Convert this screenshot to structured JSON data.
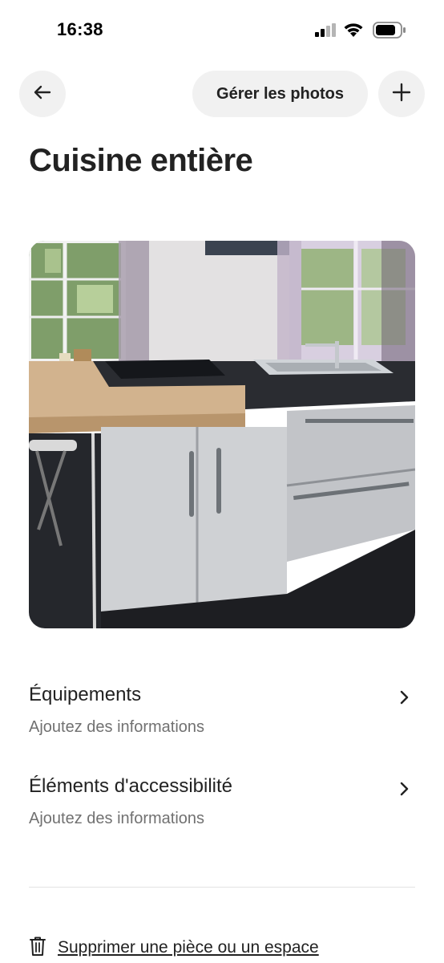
{
  "status_bar": {
    "time": "16:38",
    "icons": [
      "cellular-signal-icon",
      "wifi-icon",
      "battery-icon"
    ]
  },
  "header": {
    "back_icon": "arrow-left-icon",
    "manage_photos_label": "Gérer les photos",
    "add_icon": "plus-icon"
  },
  "page": {
    "title": "Cuisine entière"
  },
  "photo": {
    "subject": "kitchen"
  },
  "rows": [
    {
      "title": "Équipements",
      "subtitle": "Ajoutez des informations",
      "icon": "chevron-right-icon"
    },
    {
      "title": "Éléments d'accessibilité",
      "subtitle": "Ajoutez des informations",
      "icon": "chevron-right-icon"
    }
  ],
  "footer": {
    "delete_icon": "trash-icon",
    "delete_label": "Supprimer une pièce ou un espace"
  }
}
